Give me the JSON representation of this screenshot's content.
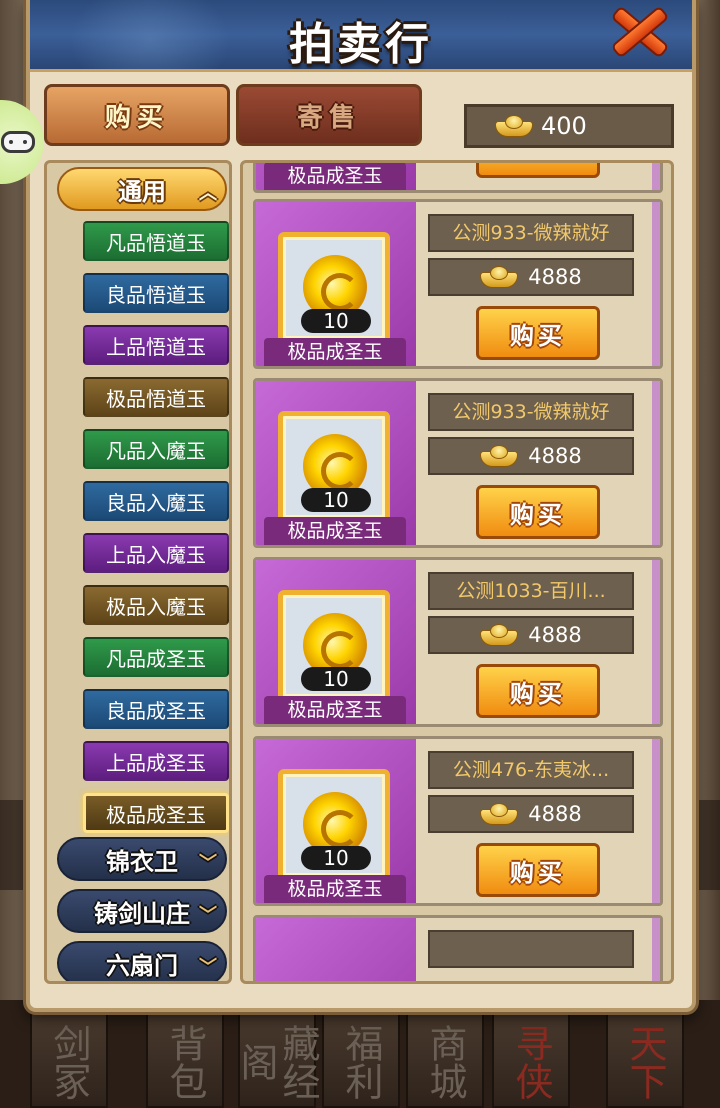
{
  "window": {
    "title": "拍卖行"
  },
  "tabs": {
    "buy": "购买",
    "sell": "寄售"
  },
  "currency": {
    "icon": "gold-ingot-icon",
    "amount": "400"
  },
  "categories": {
    "open_group": "通用",
    "items": [
      {
        "label": "凡品悟道玉",
        "color": "green"
      },
      {
        "label": "良品悟道玉",
        "color": "blue"
      },
      {
        "label": "上品悟道玉",
        "color": "purple"
      },
      {
        "label": "极品悟道玉",
        "color": "brown"
      },
      {
        "label": "凡品入魔玉",
        "color": "green"
      },
      {
        "label": "良品入魔玉",
        "color": "blue"
      },
      {
        "label": "上品入魔玉",
        "color": "purple"
      },
      {
        "label": "极品入魔玉",
        "color": "brown"
      },
      {
        "label": "凡品成圣玉",
        "color": "green"
      },
      {
        "label": "良品成圣玉",
        "color": "blue"
      },
      {
        "label": "上品成圣玉",
        "color": "purple"
      },
      {
        "label": "极品成圣玉",
        "color": "brown",
        "selected": true
      }
    ],
    "closed_groups": [
      "锦衣卫",
      "铸剑山庄",
      "六扇门"
    ]
  },
  "listings": {
    "partial_top_name": "极品成圣玉",
    "items": [
      {
        "name": "极品成圣玉",
        "qty": "10",
        "seller": "公测933-微辣就好",
        "price": "4888",
        "button": "购买"
      },
      {
        "name": "极品成圣玉",
        "qty": "10",
        "seller": "公测933-微辣就好",
        "price": "4888",
        "button": "购买"
      },
      {
        "name": "极品成圣玉",
        "qty": "10",
        "seller": "公测1033-百川...",
        "price": "4888",
        "button": "购买"
      },
      {
        "name": "极品成圣玉",
        "qty": "10",
        "seller": "公测476-东夷冰...",
        "price": "4888",
        "button": "购买"
      }
    ]
  },
  "background_menu": [
    "剑冢",
    "背包",
    "藏经阁",
    "福利",
    "商城",
    "寻侠",
    "天下"
  ],
  "colors": {
    "title_bar": "#3b5f98",
    "panel": "#e9dcc0",
    "buy_button": "#f5a623",
    "item_art": "#b34fc4"
  }
}
